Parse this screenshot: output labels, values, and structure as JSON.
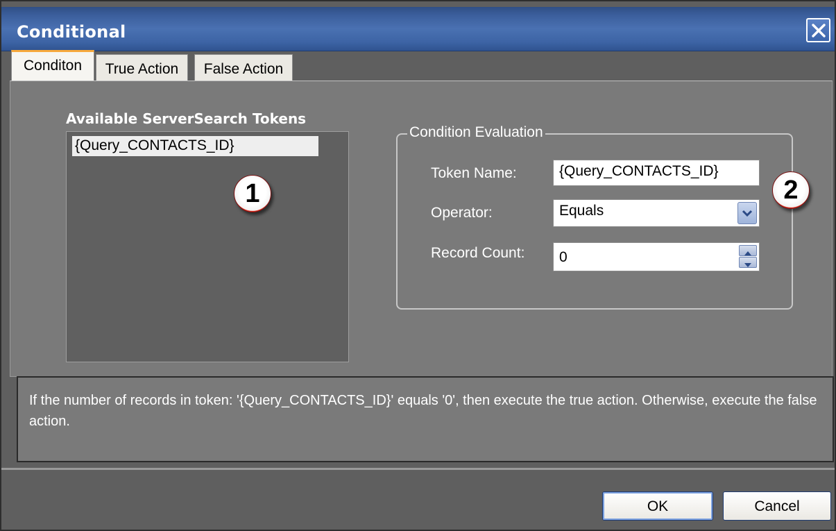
{
  "window": {
    "title": "Conditional"
  },
  "tabs": [
    {
      "label": "Conditon",
      "active": true
    },
    {
      "label": "True Action",
      "active": false
    },
    {
      "label": "False Action",
      "active": false
    }
  ],
  "tokens": {
    "title": "Available ServerSearch Tokens",
    "items": [
      "{Query_CONTACTS_ID}"
    ]
  },
  "callouts": [
    "1",
    "2"
  ],
  "condition": {
    "group_title": "Condition Evaluation",
    "token_name_label": "Token Name:",
    "token_name_value": "{Query_CONTACTS_ID}",
    "operator_label": "Operator:",
    "operator_value": "Equals",
    "record_count_label": "Record Count:",
    "record_count_value": "0"
  },
  "description": "If the number of records in token: '{Query_CONTACTS_ID}' equals '0', then execute the true action. Otherwise, execute the false action.",
  "buttons": {
    "ok": "OK",
    "cancel": "Cancel"
  },
  "icons": {
    "close": "close-icon",
    "dropdown": "chevron-down-icon",
    "spin_up": "spin-up-icon",
    "spin_down": "spin-down-icon"
  },
  "colors": {
    "titlebar": "#3c5f9d",
    "tab_active_accent": "#f7a93c",
    "callout_ring": "#c01810"
  }
}
